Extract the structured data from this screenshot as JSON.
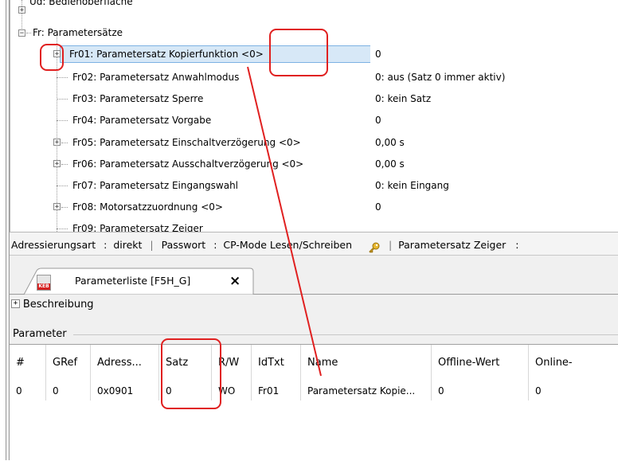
{
  "tree": {
    "items": [
      {
        "label": "Ud: Bedienoberfläche",
        "value": "",
        "expander": "+"
      },
      {
        "label": "Fr: Parametersätze",
        "value": "",
        "expander": "−"
      },
      {
        "label": "Fr01: Parametersatz Kopierfunktion <0>",
        "value": "0",
        "expander": "+",
        "selected": true
      },
      {
        "label": "Fr02: Parametersatz Anwahlmodus",
        "value": "0: aus (Satz 0 immer aktiv)",
        "expander": ""
      },
      {
        "label": "Fr03: Parametersatz Sperre",
        "value": "0: kein Satz",
        "expander": ""
      },
      {
        "label": "Fr04: Parametersatz Vorgabe",
        "value": "0",
        "expander": ""
      },
      {
        "label": "Fr05: Parametersatz Einschaltverzögerung <0>",
        "value": "0,00 s",
        "expander": "+"
      },
      {
        "label": "Fr06: Parametersatz Ausschaltverzögerung <0>",
        "value": "0,00 s",
        "expander": "+"
      },
      {
        "label": "Fr07: Parametersatz Eingangswahl",
        "value": "0: kein Eingang",
        "expander": ""
      },
      {
        "label": "Fr08: Motorsatzzuordnung <0>",
        "value": "0",
        "expander": "+"
      },
      {
        "label": "Fr09: Parametersatz Zeiger",
        "value": "",
        "expander": ""
      }
    ]
  },
  "statusbar": {
    "addr_key": "Adressierungsart",
    "addr_value": "direkt",
    "pass_key": "Passwort",
    "pass_value": "CP-Mode Lesen/Schreiben",
    "ps_key": "Parametersatz Zeiger",
    "colon": ":",
    "sep": "|"
  },
  "tab": {
    "title": "Parameterliste [F5H_G]",
    "close": "×",
    "icon_text": "KEB"
  },
  "description": {
    "expander": "+",
    "label": "Beschreibung"
  },
  "params_label": "Parameter",
  "grid": {
    "columns": [
      "#",
      "GRef",
      "Adress...",
      "Satz",
      "R/W",
      "IdTxt",
      "Name",
      "Offline-Wert",
      "Online-"
    ],
    "rows": [
      [
        "0",
        "0",
        "0x0901",
        "0",
        "WO",
        "Fr01",
        "Parametersatz Kopie...",
        "0",
        "0"
      ]
    ]
  },
  "colors": {
    "annotation": "#e02020",
    "selection": "#d7e8f7",
    "selection_border": "#7db2e3"
  }
}
